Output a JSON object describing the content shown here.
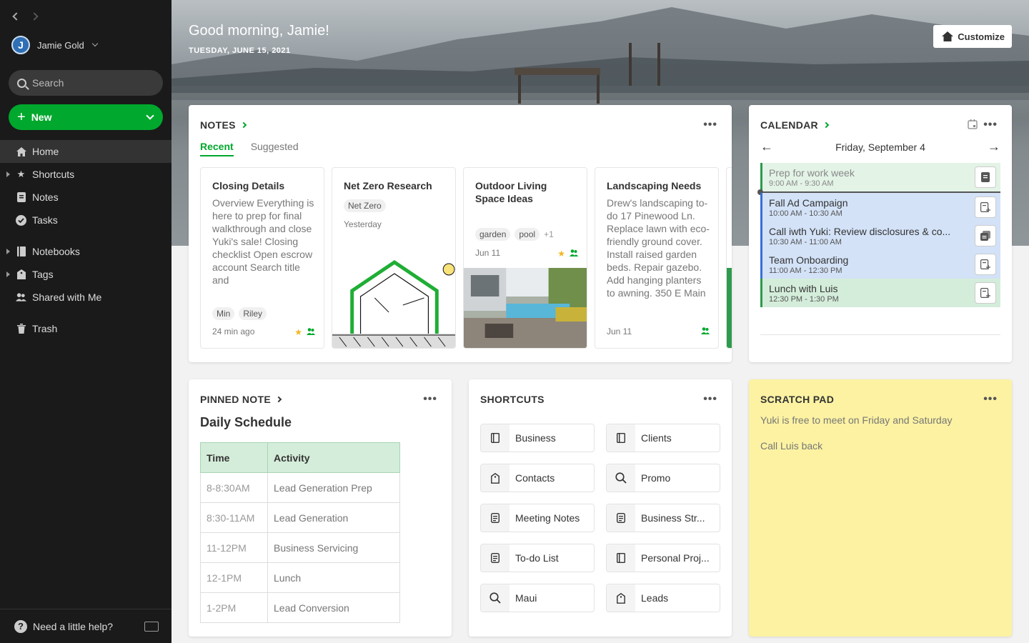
{
  "sidebar": {
    "user": {
      "initial": "J",
      "name": "Jamie Gold"
    },
    "search_placeholder": "Search",
    "new_label": "New",
    "items": [
      {
        "label": "Home",
        "icon": "home-icon"
      },
      {
        "label": "Shortcuts",
        "icon": "star-icon"
      },
      {
        "label": "Notes",
        "icon": "note-icon"
      },
      {
        "label": "Tasks",
        "icon": "check-circle-icon"
      },
      {
        "label": "Notebooks",
        "icon": "notebook-icon"
      },
      {
        "label": "Tags",
        "icon": "tag-icon"
      },
      {
        "label": "Shared with Me",
        "icon": "people-icon"
      },
      {
        "label": "Trash",
        "icon": "trash-icon"
      }
    ],
    "help_label": "Need a little help?"
  },
  "hero": {
    "greeting": "Good morning, Jamie!",
    "date": "TUESDAY, JUNE 15, 2021",
    "customize_label": "Customize"
  },
  "notes_widget": {
    "title": "NOTES",
    "tabs": [
      "Recent",
      "Suggested"
    ],
    "notes": [
      {
        "title": "Closing Details",
        "body": "Overview Everything is here to prep for final walkthrough and close Yuki's sale! Closing checklist Open escrow account Search title and",
        "tags": [
          "Min",
          "Riley"
        ],
        "time": "24 min ago"
      },
      {
        "title": "Net Zero Research",
        "tags": [
          "Net Zero"
        ],
        "time": "Yesterday"
      },
      {
        "title": "Outdoor Living Space Ideas",
        "tags": [
          "garden",
          "pool"
        ],
        "more": "+1",
        "time": "Jun 11"
      },
      {
        "title": "Landscaping Needs",
        "body": "Drew's landscaping to-do 17 Pinewood Ln. Replace lawn with eco-friendly ground cover. Install raised garden beds. Repair gazebo. Add hanging planters to awning. 350 E Main",
        "time": "Jun 11"
      }
    ]
  },
  "calendar": {
    "title": "CALENDAR",
    "day": "Friday, September 4",
    "events": [
      {
        "title": "Prep for work week",
        "time": "9:00 AM - 9:30 AM"
      },
      {
        "title": "Fall Ad Campaign",
        "time": "10:00 AM - 10:30 AM"
      },
      {
        "title": "Call iwth Yuki: Review disclosures & co...",
        "time": "10:30 AM - 11:00 AM"
      },
      {
        "title": "Team Onboarding",
        "time": "11:00 AM - 12:30 PM"
      },
      {
        "title": "Lunch with Luis",
        "time": "12:30 PM - 1:30 PM"
      }
    ]
  },
  "pinned": {
    "title": "PINNED NOTE",
    "note_title": "Daily Schedule",
    "headers": [
      "Time",
      "Activity"
    ],
    "rows": [
      [
        "8-8:30AM",
        "Lead Generation Prep"
      ],
      [
        "8:30-11AM",
        "Lead Generation"
      ],
      [
        "11-12PM",
        "Business Servicing"
      ],
      [
        "12-1PM",
        "Lunch"
      ],
      [
        "1-2PM",
        "Lead Conversion"
      ]
    ]
  },
  "shortcuts": {
    "title": "SHORTCUTS",
    "items": [
      {
        "label": "Business",
        "icon": "notebook-icon"
      },
      {
        "label": "Clients",
        "icon": "notebook-icon"
      },
      {
        "label": "Contacts",
        "icon": "tag-icon"
      },
      {
        "label": "Promo",
        "icon": "search-icon"
      },
      {
        "label": "Meeting Notes",
        "icon": "note-icon"
      },
      {
        "label": "Business Str...",
        "icon": "note-icon"
      },
      {
        "label": "To-do List",
        "icon": "note-icon"
      },
      {
        "label": "Personal Proj...",
        "icon": "notebook-icon"
      },
      {
        "label": "Maui",
        "icon": "search-icon"
      },
      {
        "label": "Leads",
        "icon": "tag-icon"
      }
    ]
  },
  "scratch": {
    "title": "SCRATCH PAD",
    "lines": [
      "Yuki is free to meet on Friday and Saturday",
      "Call Luis back"
    ]
  },
  "colors": {
    "brand_green": "#00a82d",
    "sidebar_bg": "#1a1a1a",
    "scratch_bg": "#fcf2a2",
    "event_blue": "#d3e2f7",
    "event_green": "#d4edda"
  }
}
